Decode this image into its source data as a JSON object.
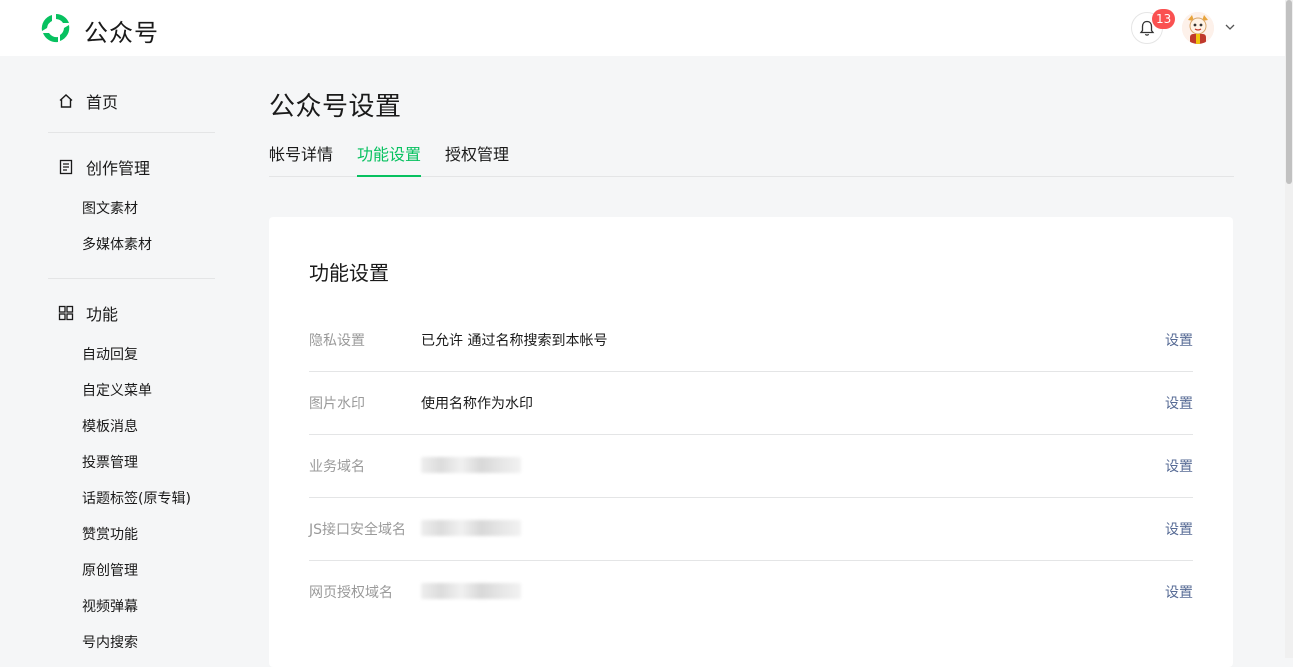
{
  "header": {
    "brand": "公众号",
    "notification_count": "13"
  },
  "sidebar": {
    "home_label": "首页",
    "creation": {
      "label": "创作管理",
      "items": [
        "图文素材",
        "多媒体素材"
      ]
    },
    "features": {
      "label": "功能",
      "items": [
        "自动回复",
        "自定义菜单",
        "模板消息",
        "投票管理",
        "话题标签(原专辑)",
        "赞赏功能",
        "原创管理",
        "视频弹幕",
        "号内搜索"
      ]
    }
  },
  "main": {
    "title": "公众号设置",
    "tabs": [
      {
        "label": "帐号详情",
        "active": false
      },
      {
        "label": "功能设置",
        "active": true
      },
      {
        "label": "授权管理",
        "active": false
      }
    ],
    "card": {
      "title": "功能设置",
      "rows": [
        {
          "label": "隐私设置",
          "value": "已允许 通过名称搜索到本帐号",
          "action": "设置"
        },
        {
          "label": "图片水印",
          "value": "使用名称作为水印",
          "action": "设置"
        },
        {
          "label": "业务域名",
          "value": "",
          "action": "设置"
        },
        {
          "label": "JS接口安全域名",
          "value": "",
          "action": "设置"
        },
        {
          "label": "网页授权域名",
          "value": "",
          "action": "设置"
        }
      ]
    }
  },
  "colors": {
    "accent": "#07c160",
    "link": "#576b95",
    "badge": "#fa5151",
    "background": "#f5f6f7"
  }
}
